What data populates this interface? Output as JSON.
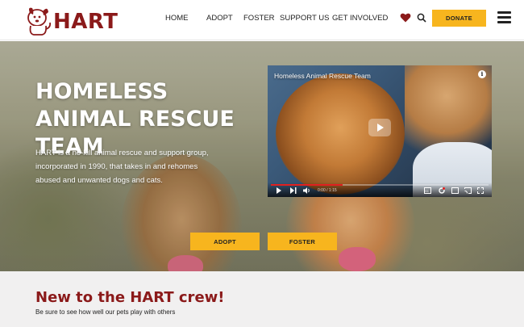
{
  "brand": {
    "logo_text": "HART",
    "primary_color": "#8b1a1a",
    "accent_color": "#f7b51e"
  },
  "nav": {
    "items": [
      "HOME",
      "ADOPT",
      "FOSTER",
      "SUPPORT US",
      "GET INVOLVED"
    ],
    "donate_label": "DONATE",
    "icons": [
      "heart-icon",
      "search-icon",
      "hamburger-menu-icon"
    ]
  },
  "hero": {
    "title": "HOMELESS ANIMAL RESCUE TEAM",
    "description": "HART is a no-kill animal rescue and support group, incorporated in 1990, that takes in and rehomes abused and unwanted dogs and cats.",
    "adopt_label": "ADOPT",
    "foster_label": "FOSTER"
  },
  "video": {
    "title": "Homeless Animal Rescue Team",
    "info_glyph": "i",
    "time": "0:00 / 1:15",
    "progress": 0.33,
    "controls": [
      "play-icon",
      "next-icon",
      "volume-icon",
      "captions-icon",
      "settings-icon",
      "miniplayer-icon",
      "cast-icon",
      "fullscreen-icon"
    ]
  },
  "section": {
    "title": "New to the HART crew!",
    "subtitle": "Be sure to see how well our pets play with others"
  }
}
